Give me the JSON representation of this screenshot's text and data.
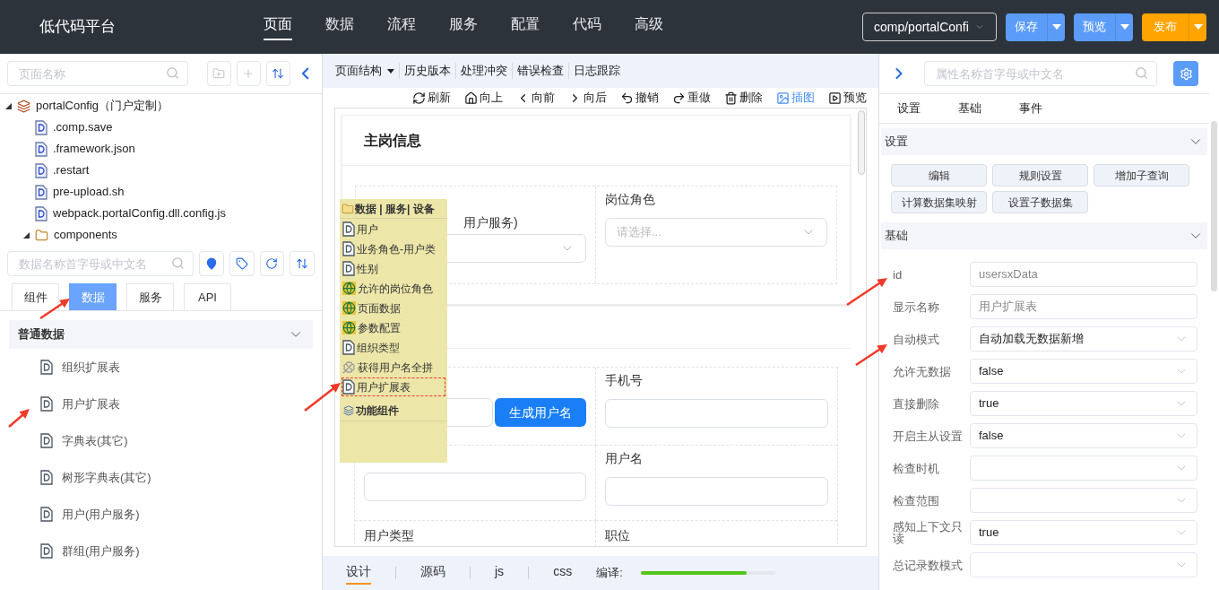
{
  "header": {
    "logo": "低代码平台",
    "nav": [
      {
        "label": "页面",
        "selected": true
      },
      {
        "label": "数据",
        "selected": false
      },
      {
        "label": "流程",
        "selected": false
      },
      {
        "label": "服务",
        "selected": false
      },
      {
        "label": "配置",
        "selected": false
      },
      {
        "label": "代码",
        "selected": false
      },
      {
        "label": "高级",
        "selected": false
      }
    ],
    "path_select": "comp/portalConfi",
    "buttons": [
      {
        "label": "保存",
        "kind": "primary"
      },
      {
        "label": "预览",
        "kind": "primary"
      },
      {
        "label": "发布",
        "kind": "warning"
      }
    ]
  },
  "left": {
    "page_search": {
      "placeholder": "页面名称"
    },
    "tree": [
      {
        "label": "portalConfig（门户定制）",
        "kind": "project",
        "expanded": true,
        "children": [
          {
            "label": ".comp.save",
            "kind": "file"
          },
          {
            "label": ".framework.json",
            "kind": "file"
          },
          {
            "label": ".restart",
            "kind": "file"
          },
          {
            "label": "pre-upload.sh",
            "kind": "file"
          },
          {
            "label": "webpack.portalConfig.dll.config.js",
            "kind": "file"
          },
          {
            "label": "components",
            "kind": "folder",
            "expanded": true
          }
        ]
      }
    ],
    "data_search": {
      "placeholder": "数据名称首字母或中文名"
    },
    "tabs": [
      {
        "label": "组件",
        "selected": false
      },
      {
        "label": "数据",
        "selected": true
      },
      {
        "label": "服务",
        "selected": false
      },
      {
        "label": "API",
        "selected": false
      }
    ],
    "section": {
      "title": "普通数据",
      "expanded": true
    },
    "items": [
      "组织扩展表",
      "用户扩展表",
      "字典表(其它)",
      "树形字典表(其它)",
      "用户(用户服务)",
      "群组(用户服务)"
    ]
  },
  "center": {
    "menu": [
      {
        "label": "页面结构",
        "kind": "dropdown"
      },
      {
        "label": "历史版本",
        "kind": "plain"
      },
      {
        "label": "处理冲突",
        "kind": "plain"
      },
      {
        "label": "错误检查",
        "kind": "plain"
      },
      {
        "label": "日志跟踪",
        "kind": "plain"
      }
    ],
    "actions": [
      {
        "label": "刷新",
        "kind": "refresh",
        "active": false
      },
      {
        "label": "向上",
        "kind": "home",
        "active": false
      },
      {
        "label": "向前",
        "kind": "back",
        "active": false
      },
      {
        "label": "向后",
        "kind": "forward",
        "active": false
      },
      {
        "label": "撤销",
        "kind": "undo",
        "active": false
      },
      {
        "label": "重做",
        "kind": "redo",
        "active": false
      },
      {
        "label": "删除",
        "kind": "delete",
        "active": false
      },
      {
        "label": "插图",
        "kind": "image",
        "active": true
      },
      {
        "label": "预览",
        "kind": "preview",
        "active": false
      }
    ],
    "form": {
      "title": "主岗信息",
      "row1": [
        {
          "value": "用户服务)"
        },
        {
          "label": "岗位角色",
          "placeholder": "请选择..."
        }
      ],
      "button": "生成用户名",
      "row2_right": "手机号",
      "row3": [
        "用户名"
      ],
      "row4": [
        "用户类型",
        "职位"
      ]
    },
    "popup": {
      "title": "数据 | 服务| 设备",
      "items": [
        {
          "label": "用户",
          "kind": "data",
          "selected": false
        },
        {
          "label": "业务角色-用户类",
          "kind": "data",
          "selected": false
        },
        {
          "label": "性别",
          "kind": "data",
          "selected": false
        },
        {
          "label": "允许的岗位角色",
          "kind": "global",
          "selected": false
        },
        {
          "label": "页面数据",
          "kind": "global",
          "selected": false
        },
        {
          "label": "参数配置",
          "kind": "global",
          "selected": false
        },
        {
          "label": "组织类型",
          "kind": "data",
          "selected": false
        },
        {
          "label": "获得用户名全拼",
          "kind": "function",
          "selected": false
        },
        {
          "label": "用户扩展表",
          "kind": "data",
          "selected": true
        }
      ],
      "group": "功能组件"
    },
    "bottom_tabs": [
      {
        "label": "设计",
        "selected": true
      },
      {
        "label": "源码",
        "selected": false
      },
      {
        "label": "js",
        "selected": false
      },
      {
        "label": "css",
        "selected": false
      }
    ],
    "compile": {
      "label": "编译:",
      "level": 0.79
    }
  },
  "right": {
    "search": {
      "placeholder": "属性名称首字母或中文名"
    },
    "tabs": [
      {
        "label": "设置",
        "selected": false
      },
      {
        "label": "基础",
        "selected": false
      },
      {
        "label": "事件",
        "selected": false
      }
    ],
    "settings": {
      "title": "设置",
      "expanded": true,
      "buttons": [
        "编辑",
        "规则设置",
        "增加子查询",
        "计算数据集映射",
        "设置子数据集"
      ]
    },
    "basic": {
      "title": "基础",
      "expanded": true,
      "props": [
        {
          "label": "id",
          "kind": "input",
          "value": "usersxData"
        },
        {
          "label": "显示名称",
          "kind": "input",
          "value": "用户扩展表"
        },
        {
          "label": "自动模式",
          "kind": "select",
          "value": "自动加载无数据新增"
        },
        {
          "label": "允许无数据",
          "kind": "select",
          "value": "false"
        },
        {
          "label": "直接删除",
          "kind": "select",
          "value": "true"
        },
        {
          "label": "开启主从设置",
          "kind": "select",
          "value": "false"
        },
        {
          "label": "检查时机",
          "kind": "select"
        },
        {
          "label": "检查范围",
          "kind": "select"
        },
        {
          "label": "感知上下文只读",
          "kind": "select",
          "value": "true"
        },
        {
          "label": "总记录数模式",
          "kind": "select"
        }
      ]
    }
  }
}
